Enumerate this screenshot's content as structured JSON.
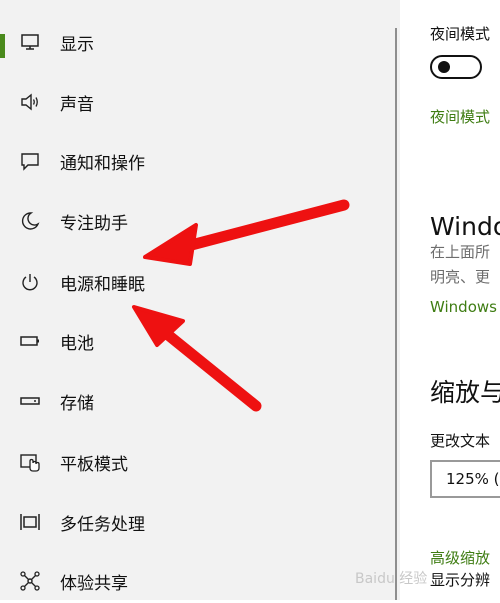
{
  "sidebar": {
    "items": [
      {
        "label": "显示",
        "icon": "monitor-icon",
        "selected": true
      },
      {
        "label": "声音",
        "icon": "speaker-icon"
      },
      {
        "label": "通知和操作",
        "icon": "message-icon"
      },
      {
        "label": "专注助手",
        "icon": "moon-icon"
      },
      {
        "label": "电源和睡眠",
        "icon": "power-icon"
      },
      {
        "label": "电池",
        "icon": "battery-icon"
      },
      {
        "label": "存储",
        "icon": "storage-icon"
      },
      {
        "label": "平板模式",
        "icon": "tablet-icon"
      },
      {
        "label": "多任务处理",
        "icon": "multitask-icon"
      },
      {
        "label": "体验共享",
        "icon": "share-icon"
      }
    ]
  },
  "content": {
    "night_mode_label": "夜间模式",
    "night_mode_toggle": "off",
    "night_mode_link": "夜间模式",
    "windows_heading": "Windo",
    "windows_desc_line1": "在上面所",
    "windows_desc_line2": "明亮、更",
    "windows_link": "Windows",
    "scale_heading": "缩放与",
    "change_text_label": "更改文本",
    "scale_value": "125% (",
    "advanced_link": "高级缩放",
    "resolution_label": "显示分辨"
  },
  "watermark": "Baidu 经验",
  "colors": {
    "sidebar_bg": "#f2f2f2",
    "accent_green": "#3f7d13",
    "arrow_red": "#ee1111"
  }
}
